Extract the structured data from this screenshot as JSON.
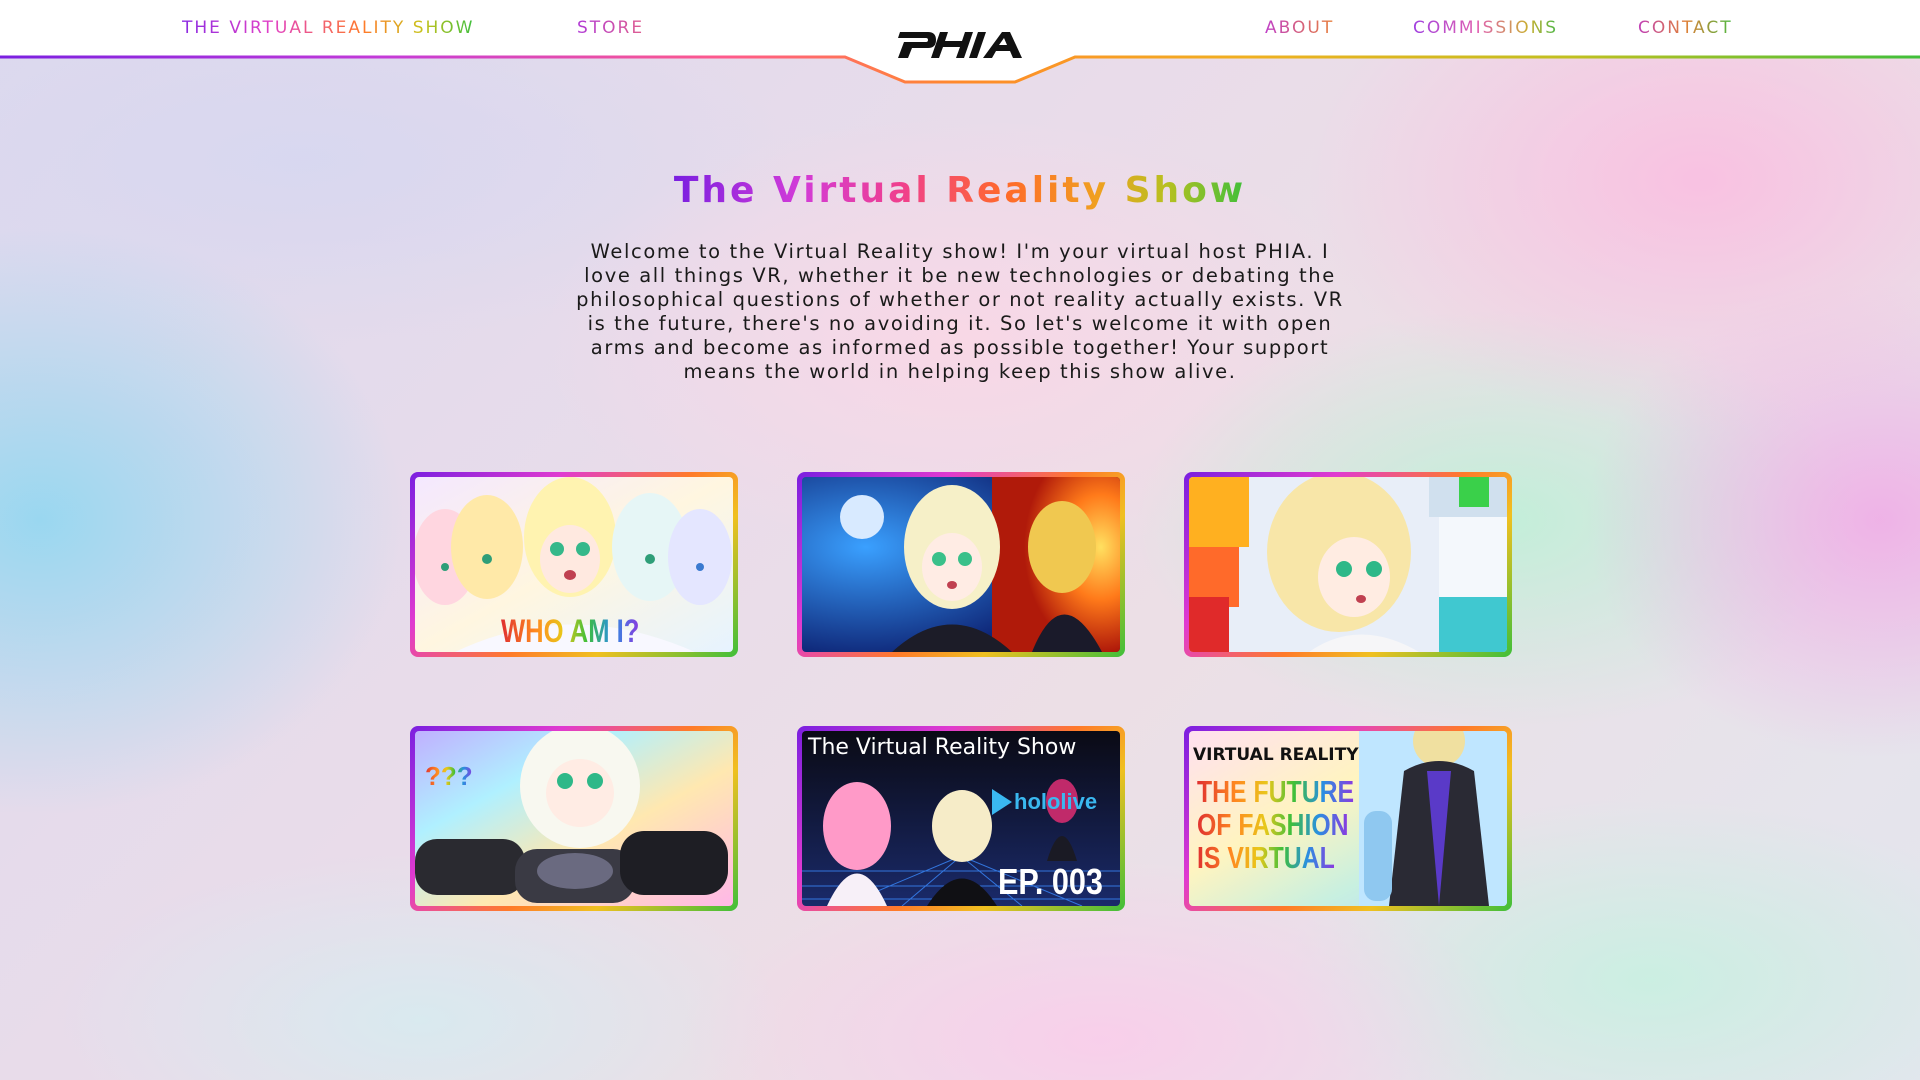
{
  "nav": {
    "left": [
      {
        "label": "THE VIRTUAL REALITY SHOW"
      },
      {
        "label": "STORE"
      }
    ],
    "logo_text": "PHIA",
    "right": [
      {
        "label": "ABOUT"
      },
      {
        "label": "COMMISSIONS"
      },
      {
        "label": "CONTACT"
      }
    ]
  },
  "hero": {
    "title": "The Virtual Reality Show",
    "description": "Welcome to the Virtual Reality show! I'm your virtual host PHIA. I love all things VR, whether it be new technologies or debating the philosophical questions of whether or not reality actually exists. VR is the future, there's no avoiding it. So let's welcome it with open arms and become as informed as possible together! Your support means the world in helping keep this show alive."
  },
  "videos": [
    {
      "caption": "WHO AM I?"
    },
    {
      "caption": ""
    },
    {
      "caption": ""
    },
    {
      "caption": "???"
    },
    {
      "caption_top": "The Virtual Reality Show",
      "caption_brand": "hololive",
      "caption_episode": "EP. 003"
    },
    {
      "caption_brand": "VIRTUAL REALITY",
      "caption_lines": [
        "THE FUTURE",
        "OF FASHION",
        "IS VIRTUAL"
      ]
    }
  ],
  "colors": {
    "gradient_start": "#7a1fe0",
    "gradient_mid": "#ff7a2a",
    "gradient_end": "#3fbf3a"
  }
}
